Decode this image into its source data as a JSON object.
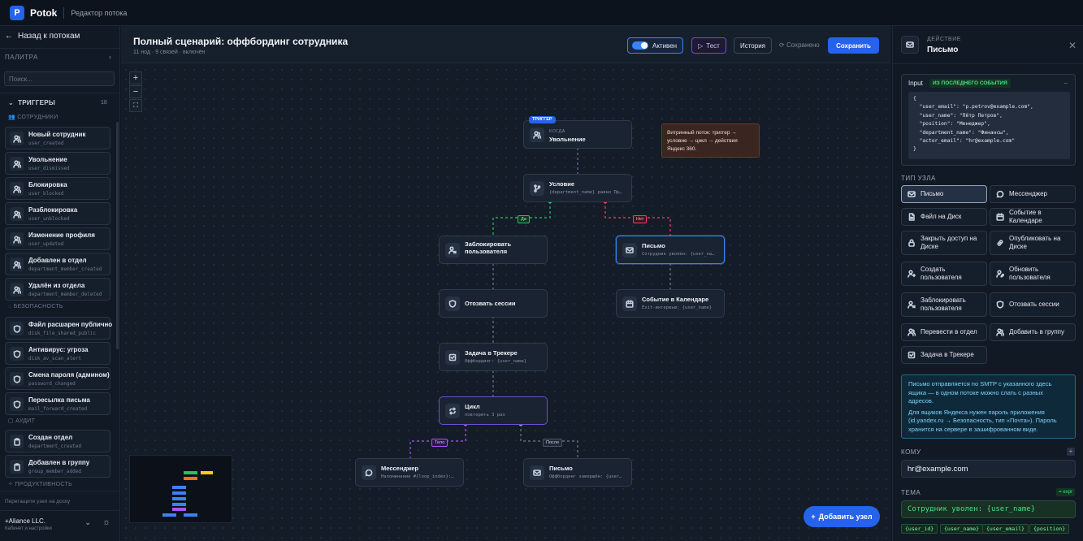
{
  "topbar": {
    "logo_letter": "P",
    "brand": "Potok",
    "subtitle": "Редактор потока"
  },
  "sidebar": {
    "back_label": "Назад к потокам",
    "palette_title": "ПАЛИТРА",
    "search_placeholder": "Поиск...",
    "triggers_label": "ТРИГГЕРЫ",
    "triggers_count": "18",
    "categories": {
      "employees": "СОТРУДНИКИ",
      "security": "БЕЗОПАСНОСТЬ",
      "audit": "АУДИТ",
      "productivity": "ПРОДУКТИВНОСТЬ"
    },
    "items": [
      {
        "name": "Новый сотрудник",
        "code": "user_created",
        "icon": "users-icon"
      },
      {
        "name": "Увольнение",
        "code": "user_dismissed",
        "icon": "users-icon"
      },
      {
        "name": "Блокировка",
        "code": "user_blocked",
        "icon": "users-icon"
      },
      {
        "name": "Разблокировка",
        "code": "user_unblocked",
        "icon": "users-icon"
      },
      {
        "name": "Изменение профиля",
        "code": "user_updated",
        "icon": "users-icon"
      },
      {
        "name": "Добавлен в отдел",
        "code": "department_member_created",
        "icon": "users-icon"
      },
      {
        "name": "Удалён из отдела",
        "code": "department_member_deleted",
        "icon": "users-icon"
      },
      {
        "name": "Файл расшарен публично",
        "code": "disk_file_shared_public",
        "icon": "shield-icon"
      },
      {
        "name": "Антивирус: угроза",
        "code": "disk_av_scan_alert",
        "icon": "shield-icon"
      },
      {
        "name": "Смена пароля (админом)",
        "code": "password_changed",
        "icon": "shield-icon"
      },
      {
        "name": "Пересылка письма",
        "code": "mail_forward_created",
        "icon": "shield-icon"
      },
      {
        "name": "Создан отдел",
        "code": "department_created",
        "icon": "clipboard-icon"
      },
      {
        "name": "Добавлен в группу",
        "code": "group_member_added",
        "icon": "clipboard-icon"
      }
    ],
    "drag_hint": "Перетащите узел на доску",
    "org_name": "+Aliance LLC.",
    "org_sub": "Кабинет и настройки"
  },
  "main": {
    "title": "Полный сценарий: оффбординг сотрудника",
    "meta": "11 нод · 9 связей · включён",
    "active_label": "Активен",
    "test_label": "Тест",
    "history_label": "История",
    "saved_label": "Сохранено",
    "save_label": "Сохранить",
    "add_node_label": "Добавить узел",
    "note": "Витринный поток: триггер → условие → цикл → действия Яндекс 360.",
    "edge_labels": {
      "yes": "Да",
      "no": "Нет",
      "body": "Тело",
      "after": "После"
    },
    "nodes": {
      "trigger": {
        "badge": "ТРИГГЕР",
        "when": "КОГДА",
        "title": "Увольнение"
      },
      "condition": {
        "title": "Условие",
        "sub": "{department_name} равно Пр…"
      },
      "block": {
        "title": "Заблокировать пользователя"
      },
      "mail1": {
        "title": "Письмо",
        "sub": "Сотрудник уволен: {user_na…"
      },
      "revoke": {
        "title": "Отозвать сессии"
      },
      "calendar": {
        "title": "Событие в Календаре",
        "sub": "Exit-интервью: {user_name}"
      },
      "task": {
        "title": "Задача в Трекере",
        "sub": "Оффбординг: {user_name}"
      },
      "loop": {
        "title": "Цикл",
        "sub": "повторить 3 раз"
      },
      "messenger": {
        "title": "Мессенджер",
        "sub": "Напоминание #{loop_index}:…"
      },
      "mail2": {
        "title": "Письмо",
        "sub": "Оффбординг завершён: {user…"
      }
    }
  },
  "panel": {
    "kicker": "ДЕЙСТВИЕ",
    "title": "Письмо",
    "input_label": "Input",
    "input_badge": "ИЗ ПОСЛЕДНЕГО СОБЫТИЯ",
    "input_code": "{\n  \"user_email\": \"p.petrov@example.com\",\n  \"user_name\": \"Пётр Петров\",\n  \"position\": \"Менеджер\",\n  \"department_name\": \"Финансы\",\n  \"actor_email\": \"hr@example.com\"\n}",
    "node_type_label": "ТИП УЗЛА",
    "types": [
      {
        "label": "Письмо",
        "icon": "mail-icon"
      },
      {
        "label": "Мессенджер",
        "icon": "chat-icon"
      },
      {
        "label": "Файл на Диск",
        "icon": "file-icon"
      },
      {
        "label": "Событие в Календаре",
        "icon": "calendar-icon"
      },
      {
        "label": "Закрыть доступ на Диске",
        "icon": "lock-icon"
      },
      {
        "label": "Опубликовать на Диске",
        "icon": "link-icon"
      },
      {
        "label": "Создать пользователя",
        "icon": "user-plus-icon"
      },
      {
        "label": "Обновить пользователя",
        "icon": "user-edit-icon"
      },
      {
        "label": "Заблокировать пользователя",
        "icon": "user-block-icon"
      },
      {
        "label": "Отозвать сессии",
        "icon": "shield-icon"
      },
      {
        "label": "Перевести в отдел",
        "icon": "users-icon"
      },
      {
        "label": "Добавить в группу",
        "icon": "users-icon"
      },
      {
        "label": "Задача в Трекере",
        "icon": "task-icon"
      }
    ],
    "info_p1": "Письмо отправляется по SMTP с указанного здесь ящика — в одном потоке можно слать с разных адресов.",
    "info_p2": "Для ящиков Яндекса нужен пароль приложения (id.yandex.ru → Безопасность, тип «Почта»). Пароль хранится на сервере в зашифрованном виде.",
    "to_label": "КОМУ",
    "to_value": "hr@example.com",
    "subject_label": "ТЕМА",
    "expr_badge": "= expr",
    "subject_value": "Сотрудник уволен: {user_name}",
    "chips": [
      "{user_id}",
      "{user_name}",
      "{user_email}",
      "{position}"
    ]
  },
  "colors": {
    "accent": "#2563eb",
    "loop": "#a855f7",
    "yes": "#22c55e",
    "no": "#f43f5e",
    "note_bg": "#3a2621"
  }
}
